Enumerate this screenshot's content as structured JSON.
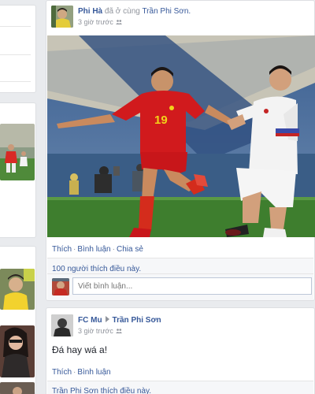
{
  "post1": {
    "author": "Phi Hà",
    "action": "đã ở cùng",
    "tagged": "Trần Phi Sơn.",
    "time": "3 giờ trước",
    "actions": [
      "Thích",
      "Bình luận",
      "Chia sẻ"
    ],
    "likes": "100 người thích điều này.",
    "comment_placeholder": "Viết bình luận...",
    "photo": {
      "left_jersey_number": "19"
    }
  },
  "post2": {
    "author": "FC Mu",
    "target": "Trần Phi Sơn",
    "time": "3 giờ trước",
    "text": "Đá hay wá a!",
    "actions": [
      "Thích",
      "Bình luận"
    ],
    "likes": "Trần Phi Sơn thích điều này."
  },
  "colors": {
    "link": "#365899",
    "background": "#e9ebee",
    "jersey_red": "#d11a1d",
    "pitch_green": "#3e7e2e"
  }
}
